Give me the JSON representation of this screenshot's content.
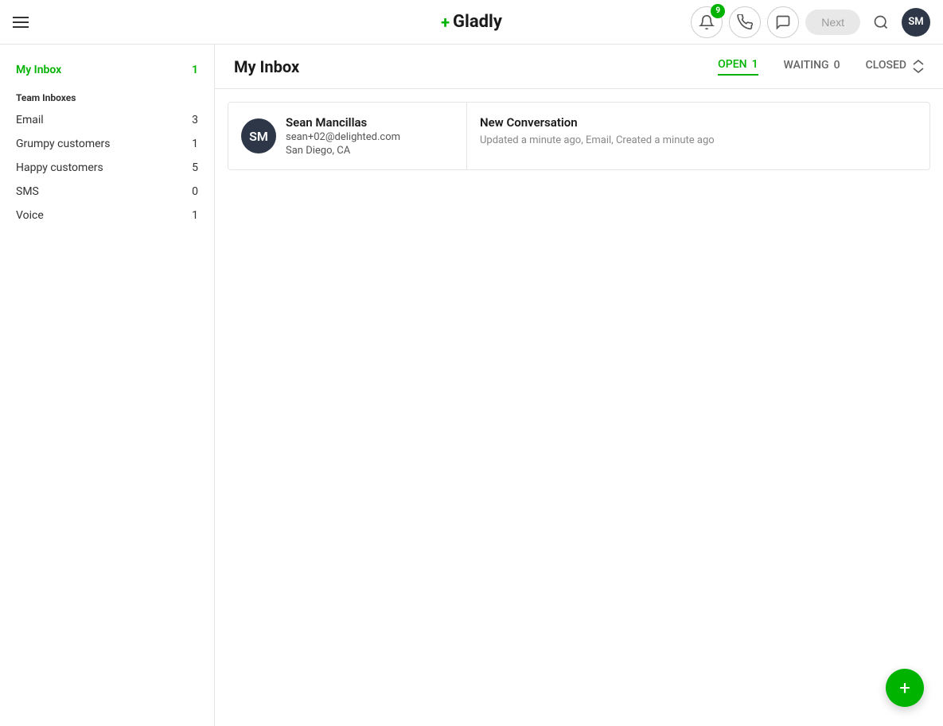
{
  "header": {
    "logo_text": "Gladly",
    "logo_plus": "+",
    "badge_count": "9",
    "next_label": "Next",
    "avatar_initials": "SM"
  },
  "sidebar": {
    "my_inbox_label": "My Inbox",
    "my_inbox_count": "1",
    "team_inboxes_header": "Team Inboxes",
    "items": [
      {
        "label": "Email",
        "count": "3"
      },
      {
        "label": "Grumpy customers",
        "count": "1"
      },
      {
        "label": "Happy customers",
        "count": "5"
      },
      {
        "label": "SMS",
        "count": "0"
      },
      {
        "label": "Voice",
        "count": "1"
      }
    ]
  },
  "main": {
    "title": "My Inbox",
    "tabs": [
      {
        "label": "OPEN",
        "count": "1",
        "active": true
      },
      {
        "label": "WAITING",
        "count": "0",
        "active": false
      },
      {
        "label": "CLOSED",
        "count": "",
        "active": false
      }
    ]
  },
  "conversation": {
    "contact_name": "Sean Mancillas",
    "contact_email": "sean+02@delighted.com",
    "contact_location": "San Diego, CA",
    "contact_initials": "SM",
    "conv_title": "New Conversation",
    "conv_meta": "Updated a minute ago, Email, Created a minute ago"
  }
}
